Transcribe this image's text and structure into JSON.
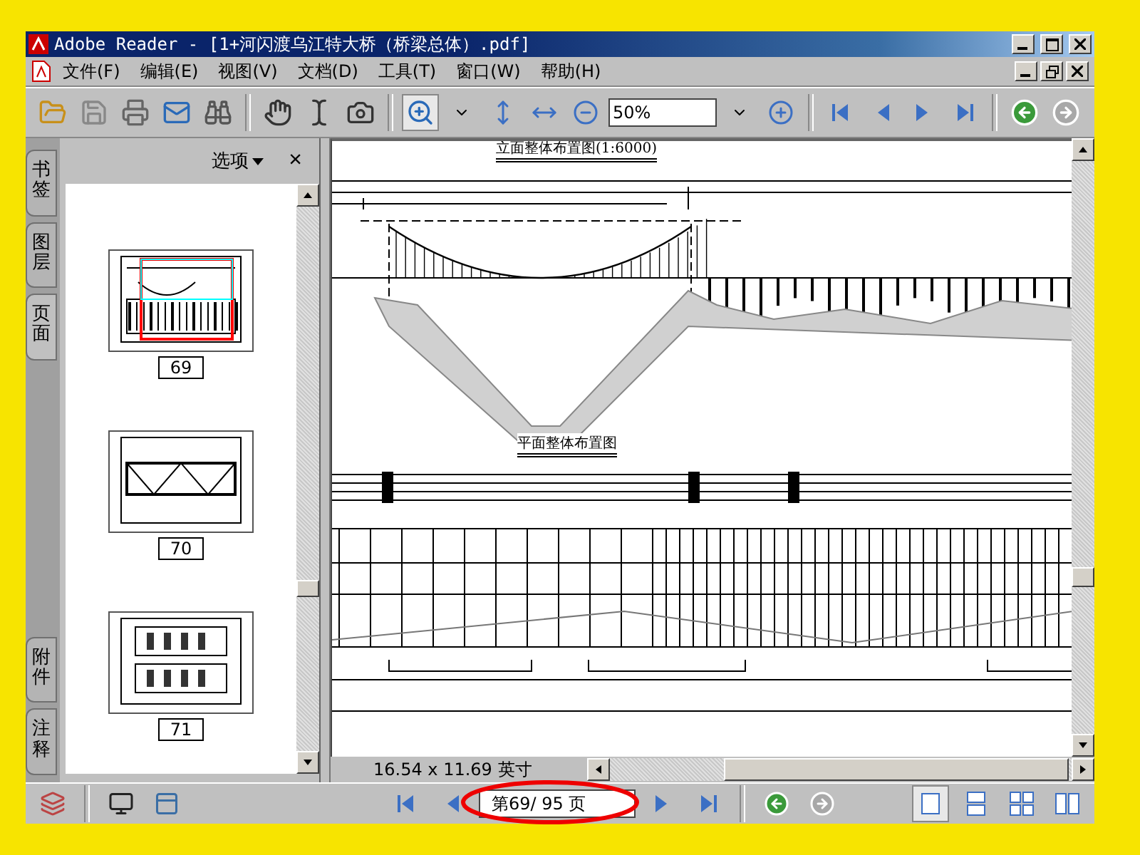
{
  "window": {
    "title": "Adobe Reader - [1+河闪渡乌江特大桥（桥梁总体）.pdf]"
  },
  "menus": [
    "文件(F)",
    "编辑(E)",
    "视图(V)",
    "文档(D)",
    "工具(T)",
    "窗口(W)",
    "帮助(H)"
  ],
  "toolbar": {
    "zoom": "50%"
  },
  "side_tabs": [
    {
      "label": "书签",
      "selected": false
    },
    {
      "label": "图层",
      "selected": false
    },
    {
      "label": "页面",
      "selected": true
    },
    {
      "label": "附件",
      "selected": false
    },
    {
      "label": "注释",
      "selected": false
    }
  ],
  "panel": {
    "options": "选项",
    "close": "×",
    "thumbnails": [
      {
        "page": "69",
        "kind": "bridge",
        "selected": true
      },
      {
        "page": "70",
        "kind": "truss",
        "selected": false
      },
      {
        "page": "71",
        "kind": "sections",
        "selected": false
      }
    ]
  },
  "document": {
    "titles": [
      "立面整体布置图(1:6000)",
      "平面整体布置图"
    ],
    "page_size": "16.54 x 11.69 英寸"
  },
  "navigation": {
    "page_field": "第69/ 95 页"
  },
  "view_modes": [
    {
      "kind": "single",
      "selected": true
    },
    {
      "kind": "continuous",
      "selected": false
    },
    {
      "kind": "grid",
      "selected": false
    },
    {
      "kind": "facing",
      "selected": false
    }
  ]
}
